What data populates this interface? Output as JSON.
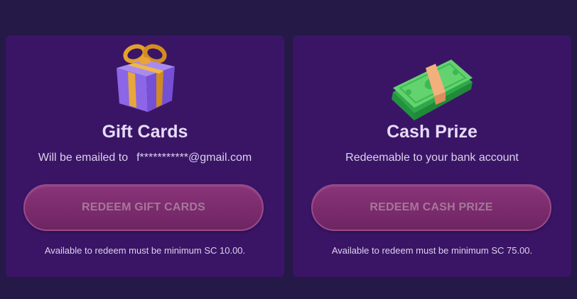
{
  "gift_cards": {
    "icon": "gift-box-icon",
    "title": "Gift Cards",
    "subtitle_prefix": "Will be emailed to",
    "email": "f***********@gmail.com",
    "button_label": "REDEEM GIFT CARDS",
    "note": "Available to redeem must be minimum SC 10.00."
  },
  "cash_prize": {
    "icon": "cash-stack-icon",
    "title": "Cash Prize",
    "subtitle": "Redeemable to your bank account",
    "button_label": "REDEEM CASH PRIZE",
    "note": "Available to redeem must be minimum SC 75.00."
  },
  "colors": {
    "page_background": "#251947",
    "card_background": "#3a1566",
    "button_background": "#7d2c6f",
    "button_text": "#a67799"
  }
}
